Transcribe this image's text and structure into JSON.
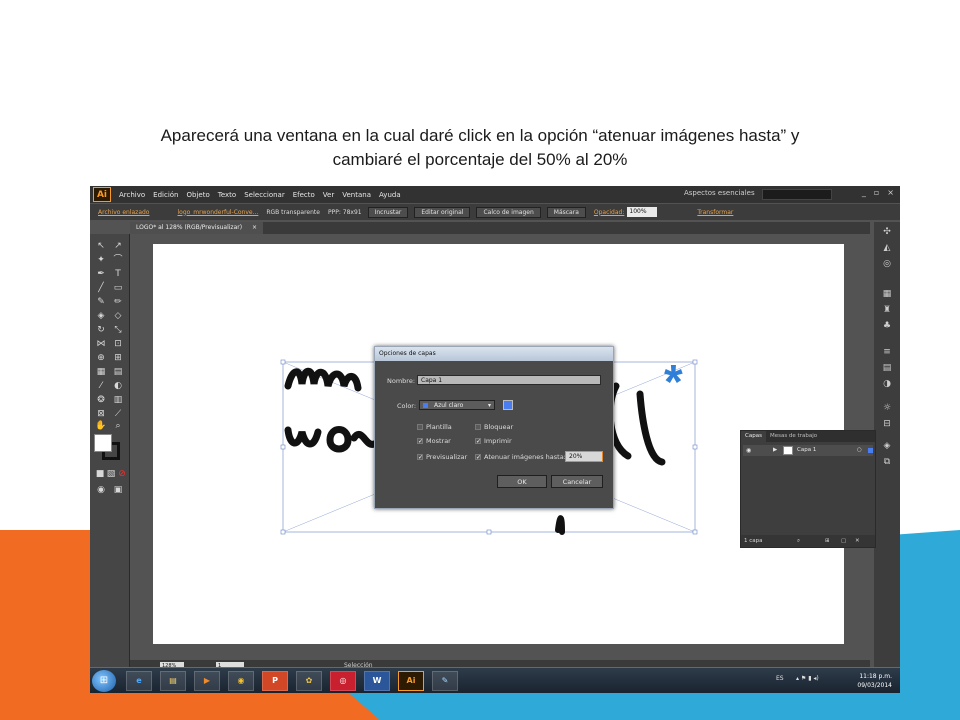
{
  "slide": {
    "title_line1": "Aparecerá una ventana en la cual daré click  en la opción “atenuar imágenes hasta” y",
    "title_line2": "cambiaré el porcentaje del 50% al 20%"
  },
  "app": {
    "logo": "Ai",
    "menu": [
      "Archivo",
      "Edición",
      "Objeto",
      "Texto",
      "Seleccionar",
      "Efecto",
      "Ver",
      "Ventana",
      "Ayuda"
    ],
    "workspace": "Aspectos esenciales",
    "window_controls": [
      "_",
      "▫",
      "×"
    ]
  },
  "control_bar": {
    "linked": "Archivo enlazado",
    "filename": "logo_mrwonderful-Conve...",
    "color_mode": "RGB transparente",
    "ppp": "PPP: 78x91",
    "embed": "Incrustar",
    "edit_original": "Editar original",
    "image_trace": "Calco de imagen",
    "mask": "Máscara",
    "opacity_label": "Opacidad:",
    "opacity_value": "100%",
    "transform": "Transformar"
  },
  "document": {
    "tab": "LOGO* al 128% (RGB/Previsualizar)",
    "close": "×"
  },
  "statusbar": {
    "zoom": "128%",
    "page": "1",
    "tool": "Selección"
  },
  "dialog": {
    "title": "Opciones de capas",
    "name_label": "Nombre:",
    "name_value": "Capa 1",
    "color_label": "Color:",
    "color_value": "Azul claro",
    "template_label": "Plantilla",
    "lock_label": "Bloquear",
    "show_label": "Mostrar",
    "print_label": "Imprimir",
    "preview_label": "Previsualizar",
    "dim_label": "Atenuar imágenes hasta:",
    "dim_value": "20%",
    "ok": "OK",
    "cancel": "Cancelar",
    "checkmark": "✓"
  },
  "layers_panel": {
    "tab_layers": "Capas",
    "tab_artboards": "Mesas de trabajo",
    "layer_name": "Capa 1",
    "footer": "1 capa"
  },
  "taskbar": {
    "apps": [
      "e",
      "▤",
      "▶",
      "◉",
      "P",
      "✿",
      "◎",
      "W",
      "Ai",
      "✎"
    ],
    "lang": "ES",
    "time": "11:18 p.m.",
    "date": "09/03/2014"
  },
  "colors": {
    "orange": "#f26b22",
    "blue": "#2fa9d8",
    "layer_blue": "#4a7df0",
    "ai_orange": "#f79a2a"
  }
}
